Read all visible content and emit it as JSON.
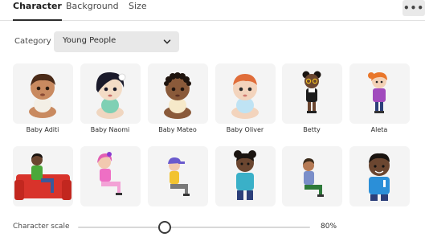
{
  "tabs": [
    "Character",
    "Background",
    "Size"
  ],
  "active_tab": "Character",
  "more_menu_glyph": "•••",
  "category": {
    "label": "Category",
    "selected": "Young People"
  },
  "characters": [
    {
      "name": "Baby Aditi",
      "icon": "baby-aditi-icon"
    },
    {
      "name": "Baby Naomi",
      "icon": "baby-naomi-icon"
    },
    {
      "name": "Baby Mateo",
      "icon": "baby-mateo-icon"
    },
    {
      "name": "Baby Oliver",
      "icon": "baby-oliver-icon"
    },
    {
      "name": "Betty",
      "icon": "betty-icon"
    },
    {
      "name": "Aleta",
      "icon": "aleta-icon"
    },
    {
      "name": "",
      "icon": "boy-on-red-couch-icon"
    },
    {
      "name": "",
      "icon": "girl-pink-hair-icon"
    },
    {
      "name": "",
      "icon": "boy-with-cap-icon"
    },
    {
      "name": "",
      "icon": "girl-with-buns-icon"
    },
    {
      "name": "",
      "icon": "boy-sitting-icon"
    },
    {
      "name": "",
      "icon": "boy-blue-jersey-icon"
    }
  ],
  "scale": {
    "label": "Character scale",
    "value_text": "80%",
    "value": 0.35
  },
  "colors": {
    "tile_bg": "#f4f4f4",
    "select_bg": "#e8e8e8",
    "accent": "#2c2c2c"
  }
}
